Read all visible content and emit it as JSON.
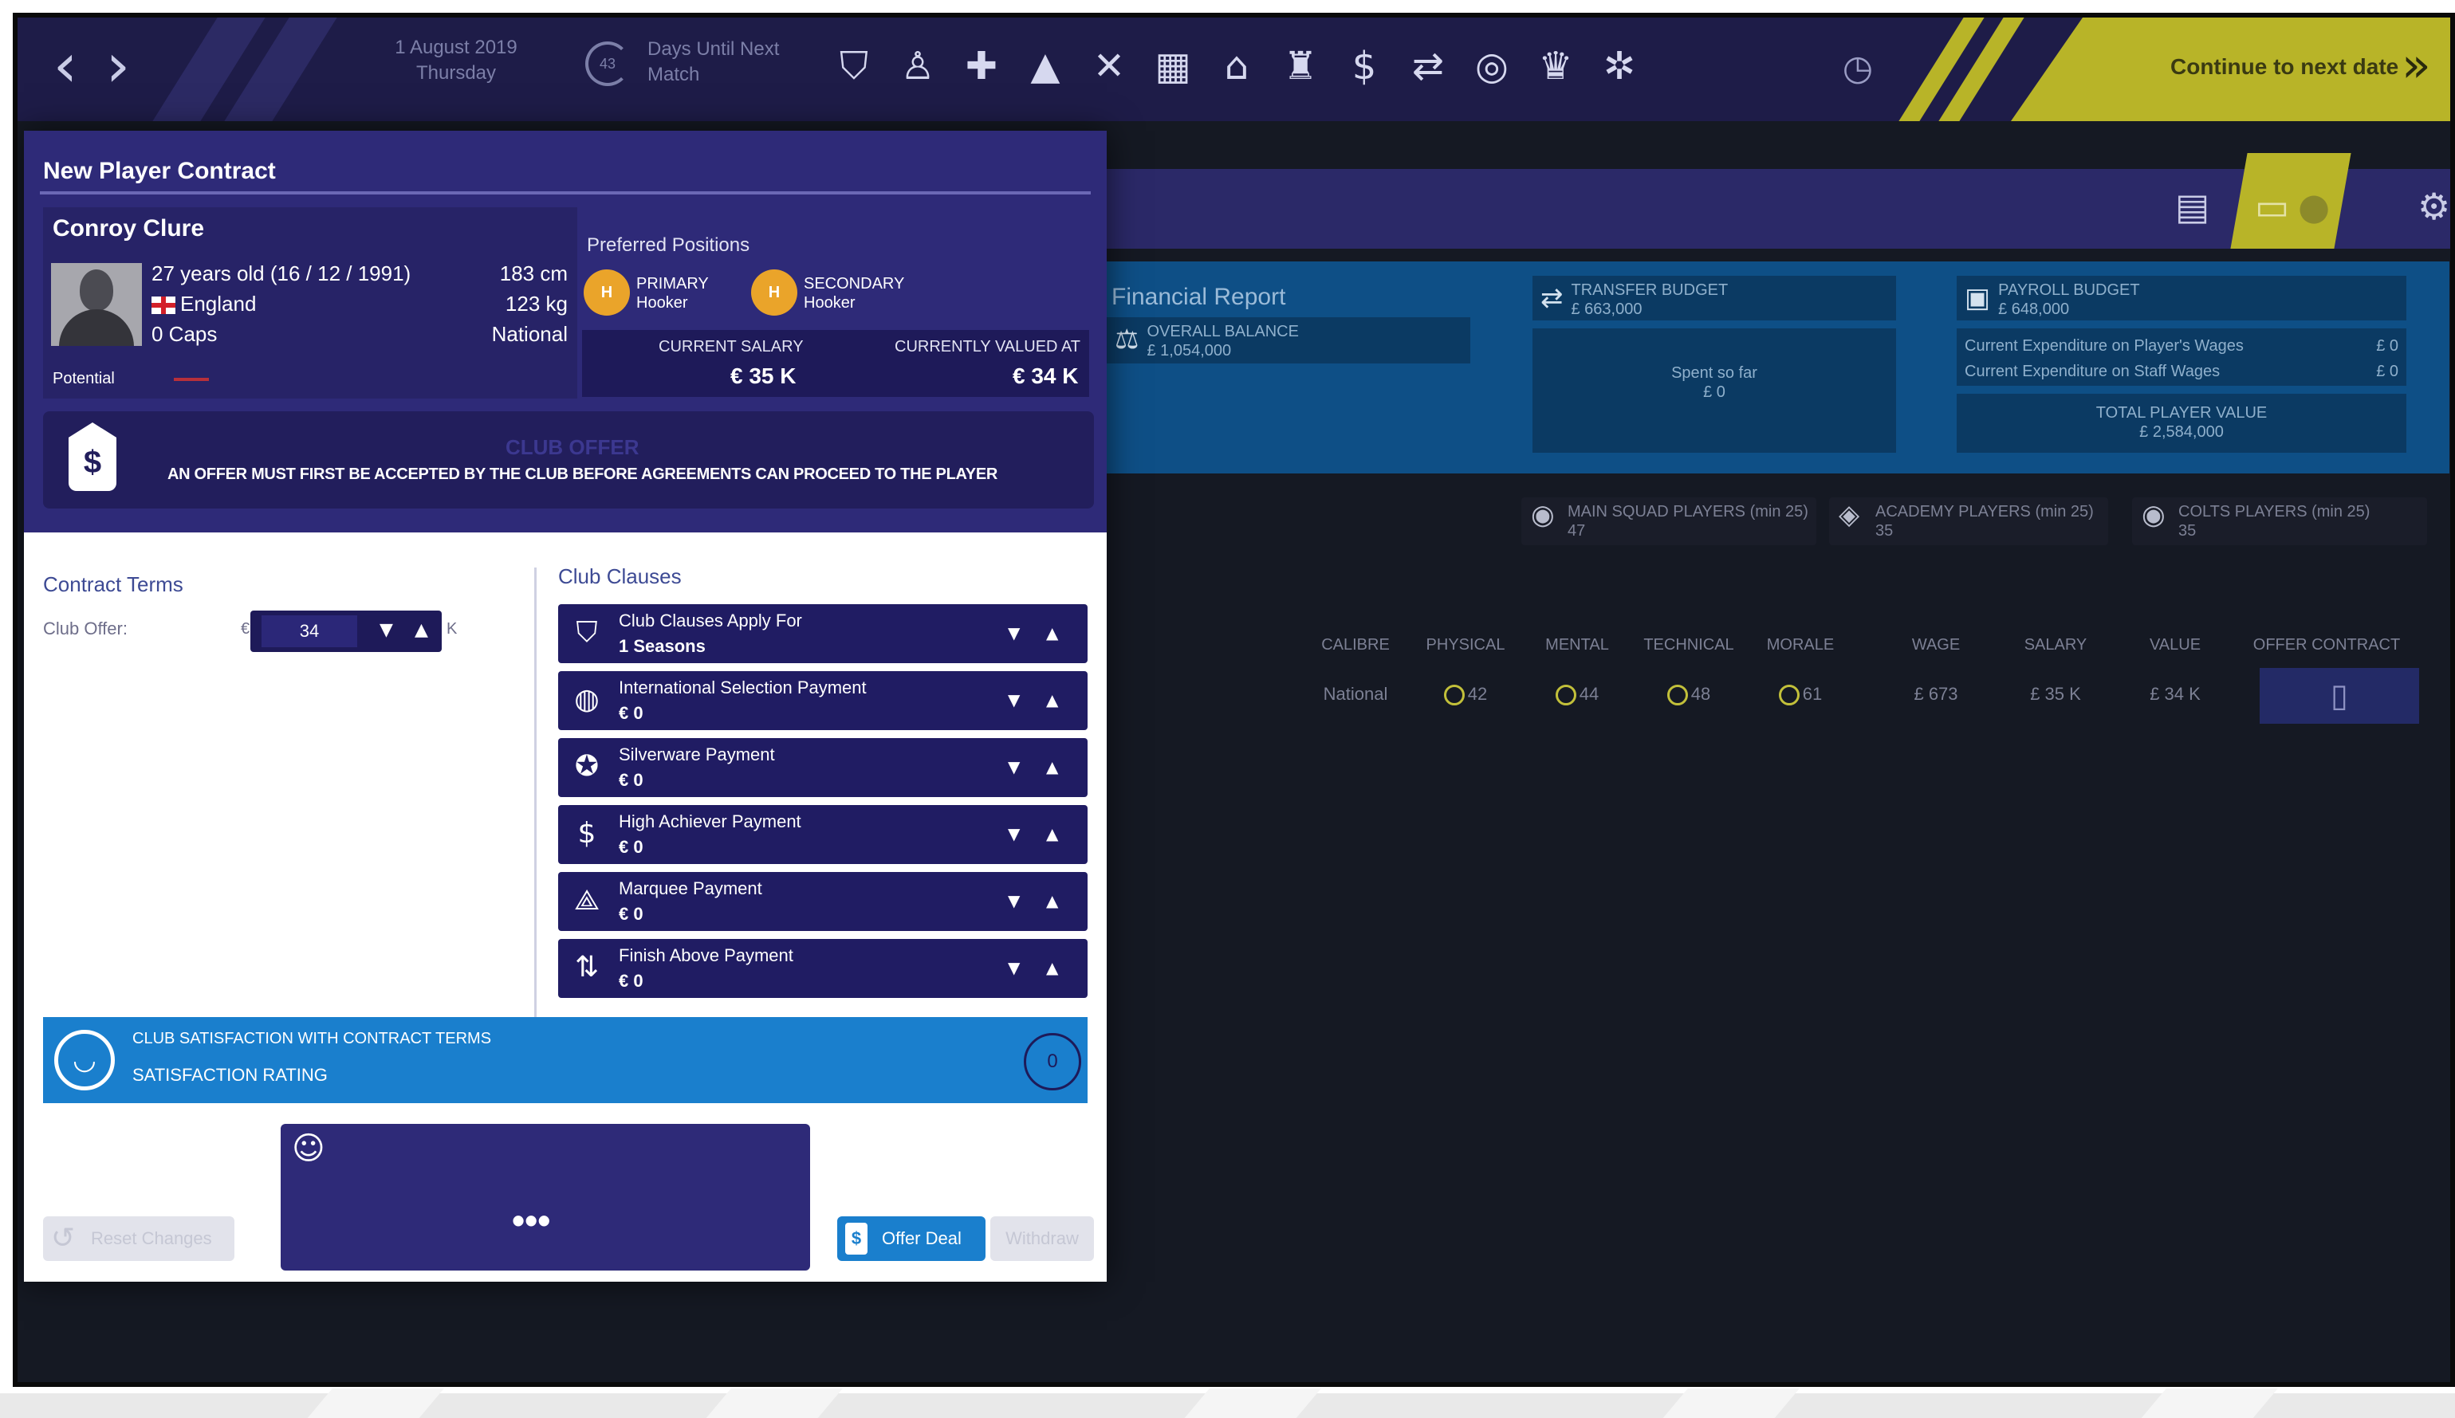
{
  "topbar": {
    "date_line1": "1 August 2019",
    "date_line2": "Thursday",
    "days_count": "43",
    "days_label_line1": "Days Until Next",
    "days_label_line2": "Match",
    "continue_label": "Continue to next date",
    "icons": [
      "shield-icon",
      "players-icon",
      "medical-icon",
      "training-cone-icon",
      "tactics-icon",
      "calendar-icon",
      "home-icon",
      "squad-icon",
      "finances-icon",
      "transfers-icon",
      "target-icon",
      "trophy-icon",
      "settings-cog-icon"
    ]
  },
  "finance": {
    "title": "Financial Report",
    "overall_balance_label": "OVERALL BALANCE",
    "overall_balance_value": "£ 1,054,000",
    "transfer_budget_label": "TRANSFER BUDGET",
    "transfer_budget_value": "£ 663,000",
    "spent_label": "Spent so far",
    "spent_value": "£ 0",
    "payroll_label": "PAYROLL BUDGET",
    "payroll_value": "£ 648,000",
    "exp_players_label": "Current Expenditure on Player's Wages",
    "exp_players_value": "£ 0",
    "exp_staff_label": "Current Expenditure on Staff Wages",
    "exp_staff_value": "£ 0",
    "total_value_label": "TOTAL PLAYER VALUE",
    "total_value_value": "£ 2,584,000"
  },
  "squad_stats": [
    {
      "label": "MAIN SQUAD PLAYERS (min 25)",
      "value": "47"
    },
    {
      "label": "ACADEMY PLAYERS (min 25)",
      "value": "35"
    },
    {
      "label": "COLTS PLAYERS (min 25)",
      "value": "35"
    }
  ],
  "table": {
    "headers": [
      "CALIBRE",
      "PHYSICAL",
      "MENTAL",
      "TECHNICAL",
      "MORALE",
      "WAGE",
      "SALARY",
      "VALUE",
      "OFFER CONTRACT"
    ],
    "row": {
      "calibre": "National",
      "physical": "42",
      "mental": "44",
      "technical": "48",
      "morale": "61",
      "wage": "£ 673",
      "salary": "£ 35 K",
      "value": "£ 34 K"
    }
  },
  "modal": {
    "title": "New Player Contract",
    "player": {
      "name": "Conroy Clure",
      "age_dob": "27 years old (16 / 12 / 1991)",
      "country": "England",
      "caps": "0 Caps",
      "height": "183 cm",
      "weight": "123 kg",
      "calibre": "National",
      "potential_label": "Potential"
    },
    "preferred_positions_title": "Preferred Positions",
    "primary": {
      "badge": "H",
      "label1": "PRIMARY",
      "label2": "Hooker"
    },
    "secondary": {
      "badge": "H",
      "label1": "SECONDARY",
      "label2": "Hooker"
    },
    "current_salary_label": "CURRENT SALARY",
    "current_salary_value": "€ 35 K",
    "valued_label": "CURRENTLY VALUED AT",
    "valued_value": "€ 34 K",
    "club_offer_title": "CLUB OFFER",
    "club_offer_text": "AN OFFER MUST FIRST BE ACCEPTED BY THE CLUB BEFORE AGREEMENTS CAN PROCEED TO THE PLAYER",
    "contract_terms_title": "Contract Terms",
    "club_offer_label": "Club Offer:",
    "club_offer_currency": "€",
    "club_offer_value": "34",
    "club_offer_unit": "K",
    "club_clauses_title": "Club Clauses",
    "clauses": [
      {
        "name": "Club Clauses Apply For",
        "value": "1  Seasons"
      },
      {
        "name": "International Selection Payment",
        "value": "€  0"
      },
      {
        "name": "Silverware Payment",
        "value": "€  0"
      },
      {
        "name": "High Achiever Payment",
        "value": "€  0"
      },
      {
        "name": "Marquee Payment",
        "value": "€  0"
      },
      {
        "name": "Finish Above Payment",
        "value": "€  0"
      }
    ],
    "satisfaction_title": "CLUB SATISFACTION WITH CONTRACT TERMS",
    "satisfaction_label": "SATISFACTION RATING",
    "satisfaction_value": "0",
    "chat_dots": "•••",
    "reset_label": "Reset Changes",
    "offer_label": "Offer Deal",
    "withdraw_label": "Withdraw"
  }
}
